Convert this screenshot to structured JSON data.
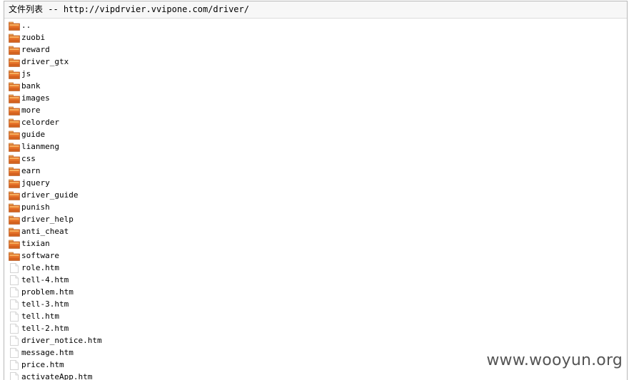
{
  "header": {
    "title": "文件列表 -- http://vipdrvier.vvipone.com/driver/"
  },
  "folder_icon": "folder-icon",
  "file_icon": "file-icon",
  "entries": [
    {
      "name": "..",
      "type": "folder"
    },
    {
      "name": "zuobi",
      "type": "folder"
    },
    {
      "name": "reward",
      "type": "folder"
    },
    {
      "name": "driver_gtx",
      "type": "folder"
    },
    {
      "name": "js",
      "type": "folder"
    },
    {
      "name": "bank",
      "type": "folder"
    },
    {
      "name": "images",
      "type": "folder"
    },
    {
      "name": "more",
      "type": "folder"
    },
    {
      "name": "celorder",
      "type": "folder"
    },
    {
      "name": "guide",
      "type": "folder"
    },
    {
      "name": "lianmeng",
      "type": "folder"
    },
    {
      "name": "css",
      "type": "folder"
    },
    {
      "name": "earn",
      "type": "folder"
    },
    {
      "name": "jquery",
      "type": "folder"
    },
    {
      "name": "driver_guide",
      "type": "folder"
    },
    {
      "name": "punish",
      "type": "folder"
    },
    {
      "name": "driver_help",
      "type": "folder"
    },
    {
      "name": "anti_cheat",
      "type": "folder"
    },
    {
      "name": "tixian",
      "type": "folder"
    },
    {
      "name": "software",
      "type": "folder"
    },
    {
      "name": "role.htm",
      "type": "file"
    },
    {
      "name": "tell-4.htm",
      "type": "file"
    },
    {
      "name": "problem.htm",
      "type": "file"
    },
    {
      "name": "tell-3.htm",
      "type": "file"
    },
    {
      "name": "tell.htm",
      "type": "file"
    },
    {
      "name": "tell-2.htm",
      "type": "file"
    },
    {
      "name": "driver_notice.htm",
      "type": "file"
    },
    {
      "name": "message.htm",
      "type": "file"
    },
    {
      "name": "price.htm",
      "type": "file"
    },
    {
      "name": "activateApp.htm",
      "type": "file"
    }
  ],
  "watermark": "www.wooyun.org",
  "colors": {
    "folder_body": "#e8752c",
    "folder_light": "#f6b060",
    "file_border": "#c8c8c8"
  }
}
